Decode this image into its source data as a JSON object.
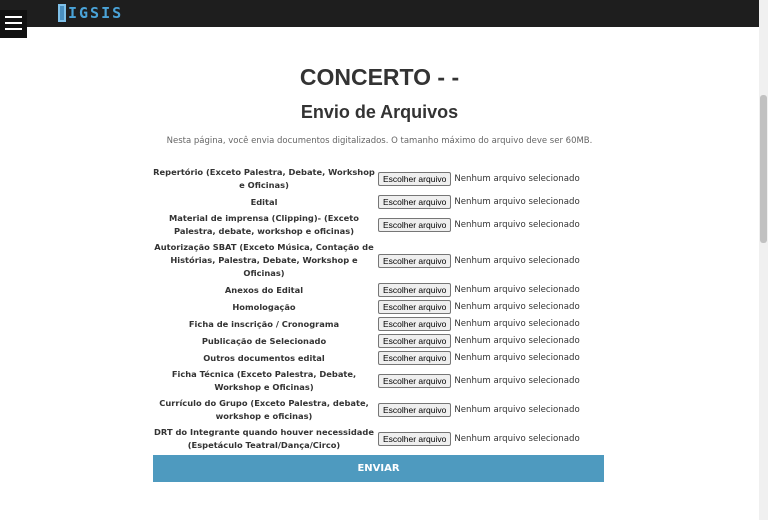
{
  "header": {
    "logo_text": "IGSIS"
  },
  "page": {
    "title": "CONCERTO - -",
    "subtitle": "Envio de Arquivos",
    "description": "Nesta página, você envia documentos digitalizados. O tamanho máximo do arquivo deve ser 60MB."
  },
  "file_input": {
    "button_label": "Escolher arquivo",
    "status_text": "Nenhum arquivo selecionado"
  },
  "files": [
    {
      "label": "Repertório (Exceto Palestra, Debate, Workshop e Oficinas)"
    },
    {
      "label": "Edital"
    },
    {
      "label": "Material de imprensa (Clipping)- (Exceto Palestra, debate, workshop e oficinas)"
    },
    {
      "label": "Autorização SBAT (Exceto Música, Contação de Histórias, Palestra, Debate, Workshop e Oficinas)"
    },
    {
      "label": "Anexos do Edital"
    },
    {
      "label": "Homologação"
    },
    {
      "label": "Ficha de inscrição / Cronograma"
    },
    {
      "label": "Publicação de Selecionado"
    },
    {
      "label": "Outros documentos edital"
    },
    {
      "label": "Ficha Técnica (Exceto Palestra, Debate, Workshop e Oficinas)"
    },
    {
      "label": "Currículo do Grupo (Exceto Palestra, debate, workshop e oficinas)"
    },
    {
      "label": "DRT do Integrante quando houver necessidade (Espetáculo Teatral/Dança/Circo)"
    }
  ],
  "submit_label": "ENVIAR"
}
